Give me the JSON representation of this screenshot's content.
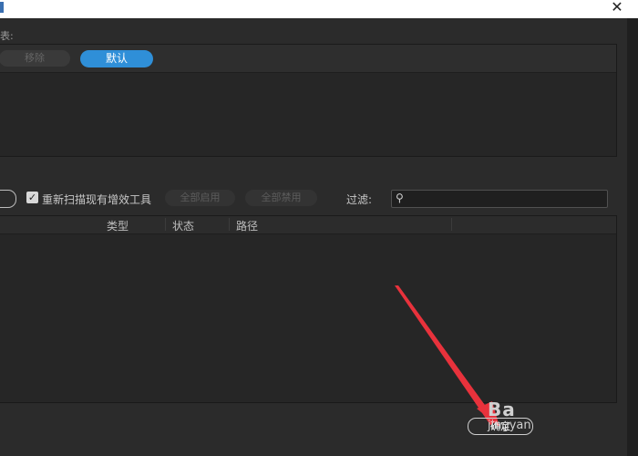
{
  "window": {
    "close_glyph": "✕"
  },
  "section": {
    "label": "表:"
  },
  "top_toolbar": {
    "remove_label": "移除",
    "default_label": "默认"
  },
  "plugin_toolbar": {
    "rescan_label": "重新扫描现有增效工具",
    "rescan_checked": true,
    "enable_all_label": "全部启用",
    "disable_all_label": "全部禁用",
    "filter_label": "过滤:",
    "filter_value": ""
  },
  "table": {
    "columns": [
      "类型",
      "状态",
      "路径"
    ]
  },
  "footer": {
    "ok_label": "确定"
  },
  "watermark": {
    "line1": "Ba",
    "line2": "jingyan"
  },
  "colors": {
    "accent": "#2f8fd8",
    "arrow": "#e8323c",
    "background": "#2b2b2b"
  }
}
